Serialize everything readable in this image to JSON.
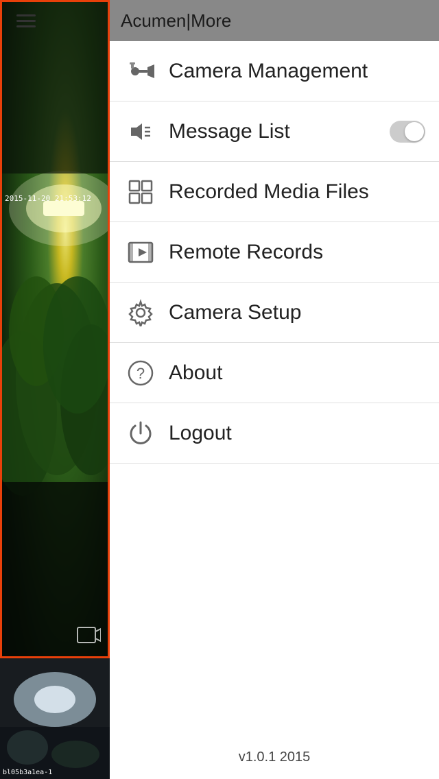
{
  "header": {
    "title": "Acumen|More"
  },
  "hamburger": {
    "label": "Menu"
  },
  "menu": {
    "items": [
      {
        "id": "camera-management",
        "label": "Camera Management",
        "icon": "camera-icon"
      },
      {
        "id": "message-list",
        "label": "Message List",
        "icon": "message-icon",
        "has_toggle": true
      },
      {
        "id": "recorded-media-files",
        "label": "Recorded Media Files",
        "icon": "media-files-icon"
      },
      {
        "id": "remote-records",
        "label": "Remote Records",
        "icon": "remote-records-icon"
      },
      {
        "id": "camera-setup",
        "label": "Camera Setup",
        "icon": "camera-setup-icon"
      },
      {
        "id": "about",
        "label": "About",
        "icon": "about-icon"
      },
      {
        "id": "logout",
        "label": "Logout",
        "icon": "logout-icon"
      }
    ]
  },
  "camera_main": {
    "timestamp": "2015-11-20 21:53:12"
  },
  "camera_small": {
    "label": "bl05b3a1ea-1"
  },
  "version": {
    "text": "v1.0.1 2015"
  }
}
